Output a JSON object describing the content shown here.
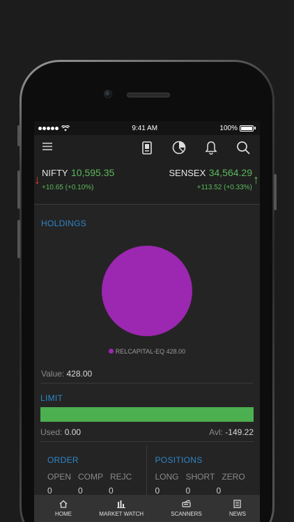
{
  "status_bar": {
    "time": "9:41 AM",
    "battery": "100%"
  },
  "indices": [
    {
      "name": "NIFTY",
      "value": "10,595.35",
      "change": "+10.65  (+0.10%)"
    },
    {
      "name": "SENSEX",
      "value": "34,564.29",
      "change": "+113.52  (+0.33%)"
    }
  ],
  "holdings": {
    "title": "HOLDINGS",
    "legend_label": "RELCAPITAL-EQ 428.00",
    "slice_color": "#9c27b0",
    "value_label": "Value:",
    "value": "428.00"
  },
  "limit": {
    "title": "LIMIT",
    "used_label": "Used:",
    "used": "0.00",
    "avl_label": "Avl:",
    "avl": "-149.22",
    "bar_color": "#4caf50"
  },
  "order": {
    "title": "ORDER",
    "columns": [
      "OPEN",
      "COMP",
      "REJC"
    ],
    "values": [
      "0",
      "0",
      "0"
    ]
  },
  "positions": {
    "title": "POSITIONS",
    "columns": [
      "LONG",
      "SHORT",
      "ZERO"
    ],
    "values": [
      "0",
      "0",
      "0"
    ]
  },
  "tabs": [
    {
      "label": "HOME",
      "icon": "home-icon"
    },
    {
      "label": "MARKET WATCH",
      "icon": "bar-chart-icon"
    },
    {
      "label": "SCANNERS",
      "icon": "scanner-icon"
    },
    {
      "label": "NEWS",
      "icon": "news-icon"
    }
  ],
  "colors": {
    "accent": "#2f86c8",
    "positive": "#5cb85c",
    "negative": "#e53935",
    "background": "#242424"
  }
}
